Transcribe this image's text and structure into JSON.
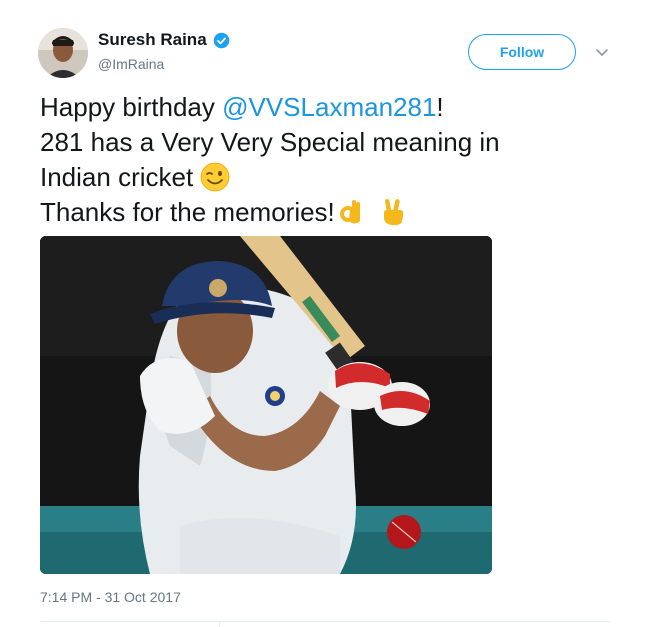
{
  "author": {
    "display_name": "Suresh Raina",
    "handle": "@ImRaina",
    "verified": true
  },
  "actions": {
    "follow_label": "Follow"
  },
  "tweet": {
    "line1_prefix": "Happy birthday ",
    "mention": "@VVSLaxman281",
    "line1_suffix": "!",
    "line2": "281 has a Very Very Special meaning in",
    "line3": "Indian cricket",
    "line4": "Thanks for the memories!",
    "emojis": [
      "winking-face",
      "ok-hand",
      "victory-hand"
    ]
  },
  "media": {
    "type": "photo",
    "description_icon": "cricket-batsman-photo"
  },
  "meta": {
    "timestamp": "7:14 PM - 31 Oct 2017"
  },
  "colors": {
    "accent": "#1da1f2",
    "mention": "#1b95e0",
    "muted": "#657786",
    "text": "#14171a"
  }
}
